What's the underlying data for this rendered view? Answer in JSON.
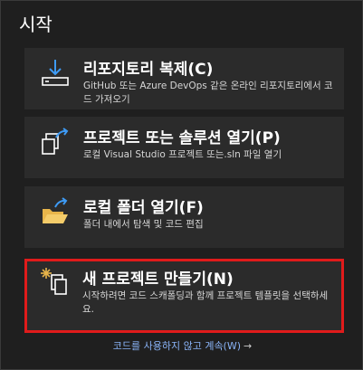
{
  "page": {
    "title": "시작"
  },
  "cards": [
    {
      "title": "리포지토리 복제(C)",
      "description": "GitHub 또는 Azure DevOps 같은 온라인 리포지토리에서 코드 가져오기",
      "icon": "clone-repository-icon"
    },
    {
      "title": "프로젝트 또는 솔루션 열기(P)",
      "description": "로컬 Visual Studio 프로젝트 또는.sln 파일 열기",
      "icon": "open-project-icon"
    },
    {
      "title": "로컬 폴더 열기(F)",
      "description": "폴더 내에서 탐색 및 코드 편집",
      "icon": "open-folder-icon"
    },
    {
      "title": "새 프로젝트 만들기(N)",
      "description": "시작하려면 코드 스캐폴딩과 함께 프로젝트 템플릿을 선택하세요.",
      "icon": "new-project-icon"
    }
  ],
  "footer": {
    "link_label": "코드를 사용하지 않고 계속(W)",
    "arrow": "→"
  },
  "colors": {
    "background": "#1f1f1f",
    "card": "#2b2b2b",
    "highlight": "#e01b1b",
    "link": "#8ab4f8",
    "accent_blue": "#3e9bf5",
    "folder": "#e8b54a"
  }
}
